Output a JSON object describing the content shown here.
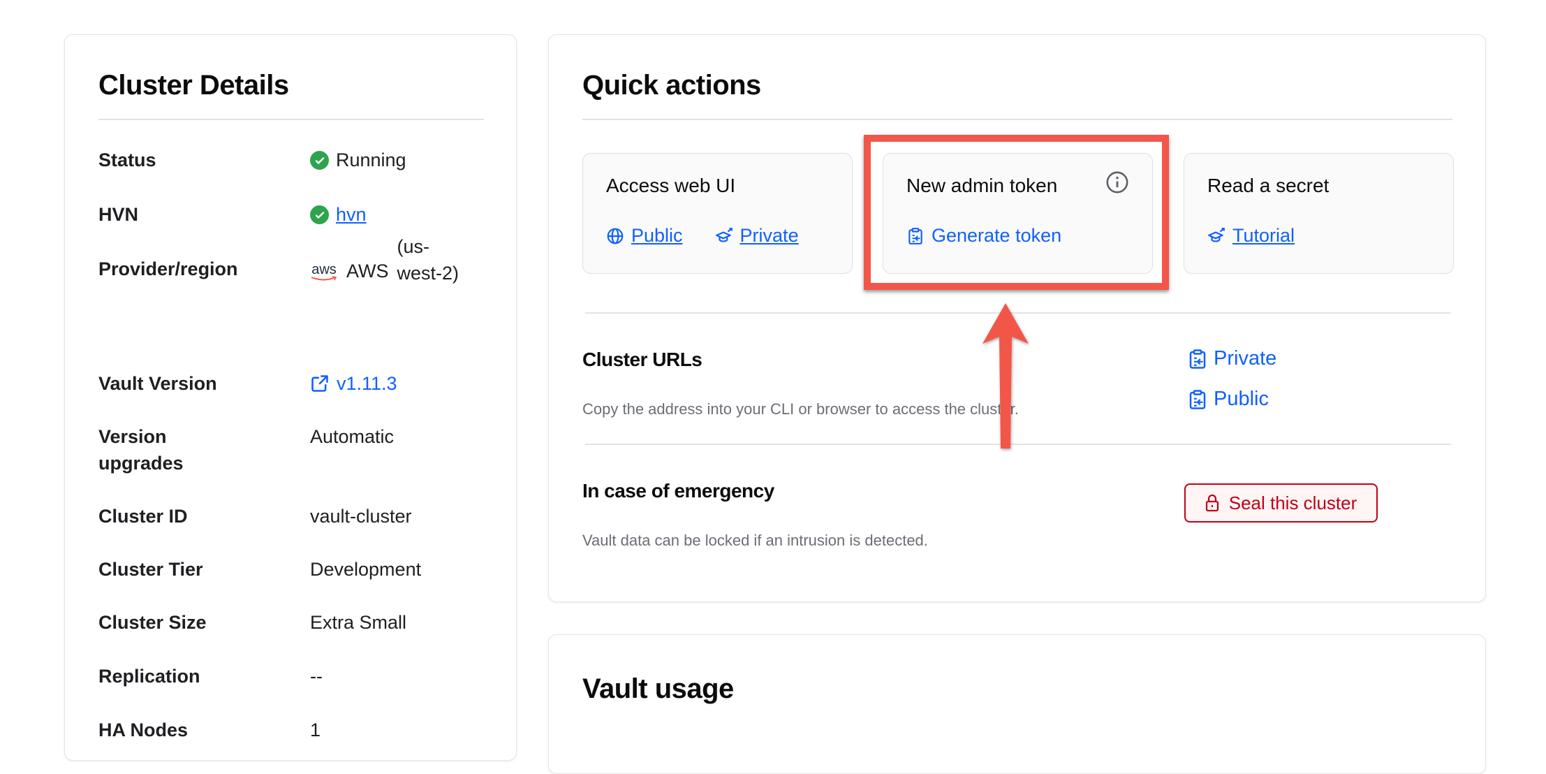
{
  "cluster_details": {
    "title": "Cluster Details",
    "rows": [
      {
        "label": "Status",
        "value": "Running",
        "icon": "check-circle-icon"
      },
      {
        "label": "HVN",
        "value": "hvn",
        "icon": "check-circle-icon",
        "link": true
      },
      {
        "label": "Provider/region",
        "provider_logo": "aws",
        "provider": "AWS",
        "region": "(us-west-2)"
      },
      {
        "label": "Vault Version",
        "value": "v1.11.3",
        "icon": "external-link-icon"
      },
      {
        "label": "Version upgrades",
        "value": "Automatic"
      },
      {
        "label": "Cluster ID",
        "value": "vault-cluster"
      },
      {
        "label": "Cluster Tier",
        "value": "Development"
      },
      {
        "label": "Cluster Size",
        "value": "Extra Small"
      },
      {
        "label": "Replication",
        "value": "--"
      },
      {
        "label": "HA Nodes",
        "value": "1"
      }
    ]
  },
  "quick_actions": {
    "title": "Quick actions",
    "tiles": [
      {
        "title": "Access web UI",
        "links": [
          {
            "label": "Public",
            "icon": "globe-icon"
          },
          {
            "label": "Private",
            "icon": "learn-icon"
          }
        ]
      },
      {
        "title": "New admin token",
        "info_icon": "info-icon",
        "links": [
          {
            "label": "Generate token",
            "icon": "clipboard-icon"
          }
        ]
      },
      {
        "title": "Read a secret",
        "links": [
          {
            "label": "Tutorial",
            "icon": "learn-icon"
          }
        ]
      }
    ],
    "cluster_urls": {
      "title": "Cluster URLs",
      "description": "Copy the address into your CLI or browser to access the cluster.",
      "links": [
        "Private",
        "Public"
      ]
    },
    "emergency": {
      "title": "In case of emergency",
      "description": "Vault data can be locked if an intrusion is detected.",
      "button_label": "Seal this cluster"
    }
  },
  "vault_usage": {
    "title": "Vault usage"
  },
  "colors": {
    "accent": "#1060ff",
    "success": "#2ea44f",
    "danger": "#c00016",
    "annotation": "#f25649"
  }
}
